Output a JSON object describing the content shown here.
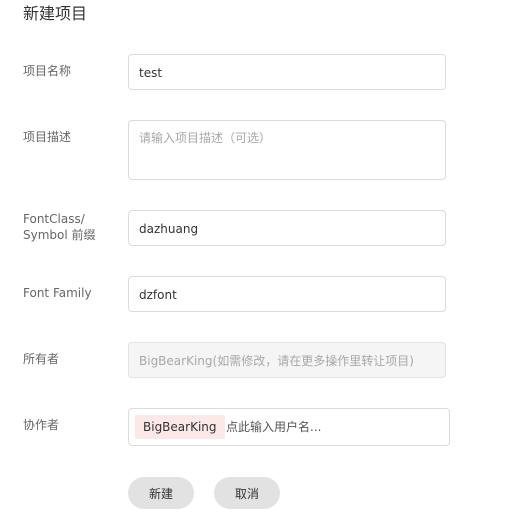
{
  "page": {
    "title": "新建项目"
  },
  "form": {
    "name": {
      "label": "项目名称",
      "value": "test"
    },
    "description": {
      "label": "项目描述",
      "placeholder": "请输入项目描述（可选）"
    },
    "prefix": {
      "label_line1": "FontClass/",
      "label_line2": "Symbol 前缀",
      "value": "dazhuang"
    },
    "font_family": {
      "label": "Font Family",
      "value": "dzfont"
    },
    "owner": {
      "label": "所有者",
      "value": "BigBearKing(如需修改，请在更多操作里转让项目)"
    },
    "collaborators": {
      "label": "协作者",
      "tags": [
        "BigBearKing"
      ],
      "placeholder": "点此输入用户名..."
    }
  },
  "actions": {
    "create_label": "新建",
    "cancel_label": "取消"
  },
  "colors": {
    "tag_background": "#fde8e8",
    "button_background": "#e2e2e2"
  }
}
